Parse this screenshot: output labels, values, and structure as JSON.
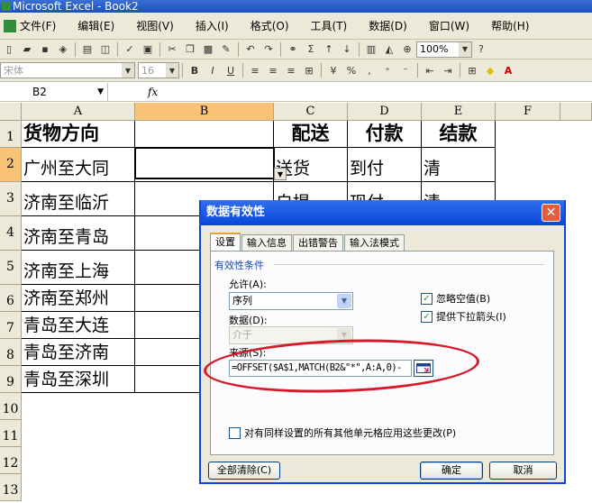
{
  "app": {
    "title": "Microsoft Excel - Book2"
  },
  "menu": [
    "文件(F)",
    "编辑(E)",
    "视图(V)",
    "插入(I)",
    "格式(O)",
    "工具(T)",
    "数据(D)",
    "窗口(W)",
    "帮助(H)"
  ],
  "toolbar": {
    "zoom": "100%",
    "font_name": "宋体",
    "font_size": "16"
  },
  "formula_bar": {
    "name_box": "B2",
    "fx_label": "fx"
  },
  "sheet": {
    "columns": [
      "A",
      "B",
      "C",
      "D",
      "E",
      "F"
    ],
    "rows": [
      "1",
      "2",
      "3",
      "4",
      "5",
      "6",
      "7",
      "8",
      "9",
      "10",
      "11",
      "12",
      "13"
    ],
    "a": [
      "货物方向",
      "广州至大同",
      "济南至临沂",
      "济南至青岛",
      "济南至上海",
      "济南至郑州",
      "青岛至大连",
      "青岛至济南",
      "青岛至深圳"
    ],
    "c": [
      "配送",
      "送货",
      "自提"
    ],
    "d": [
      "付款",
      "到付",
      "现付"
    ],
    "e": [
      "结款",
      "清",
      "清"
    ]
  },
  "dialog": {
    "title": "数据有效性",
    "tabs": [
      "设置",
      "输入信息",
      "出错警告",
      "输入法模式"
    ],
    "group_label": "有效性条件",
    "allow_label": "允许(A):",
    "allow_value": "序列",
    "data_label": "数据(D):",
    "data_value": "介于",
    "ignore_blank": "忽略空值(B)",
    "dropdown_arrow": "提供下拉箭头(I)",
    "source_label": "来源(S):",
    "source_value": "=OFFSET($A$1,MATCH(B2&\"*\",A:A,0)-",
    "apply_all": "对有同样设置的所有其他单元格应用这些更改(P)",
    "clear_all": "全部清除(C)",
    "ok": "确定",
    "cancel": "取消"
  }
}
